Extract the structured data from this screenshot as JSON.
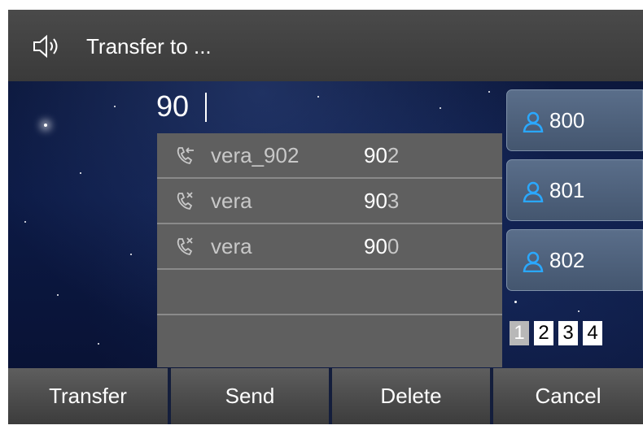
{
  "title": {
    "text": "Transfer to ...",
    "icon": "speaker-icon"
  },
  "input": {
    "value": "90"
  },
  "suggestions": [
    {
      "icon": "outgoing-call-icon",
      "name": "vera_902",
      "number_prefix": "90",
      "number_rest": "2"
    },
    {
      "icon": "missed-call-icon",
      "name": "vera",
      "number_prefix": "90",
      "number_rest": "3"
    },
    {
      "icon": "missed-call-icon",
      "name": "vera",
      "number_prefix": "90",
      "number_rest": "0"
    }
  ],
  "speed_dials": [
    {
      "icon": "contact-icon",
      "label": "800"
    },
    {
      "icon": "contact-icon",
      "label": "801"
    },
    {
      "icon": "contact-icon",
      "label": "802"
    }
  ],
  "pager": {
    "pages": [
      "1",
      "2",
      "3",
      "4"
    ],
    "current": "1"
  },
  "softkeys": [
    "Transfer",
    "Send",
    "Delete",
    "Cancel"
  ],
  "colors": {
    "accent_blue": "#2aa8ff",
    "panel_gray": "#5f5f5f",
    "titlebar": "#404040"
  }
}
